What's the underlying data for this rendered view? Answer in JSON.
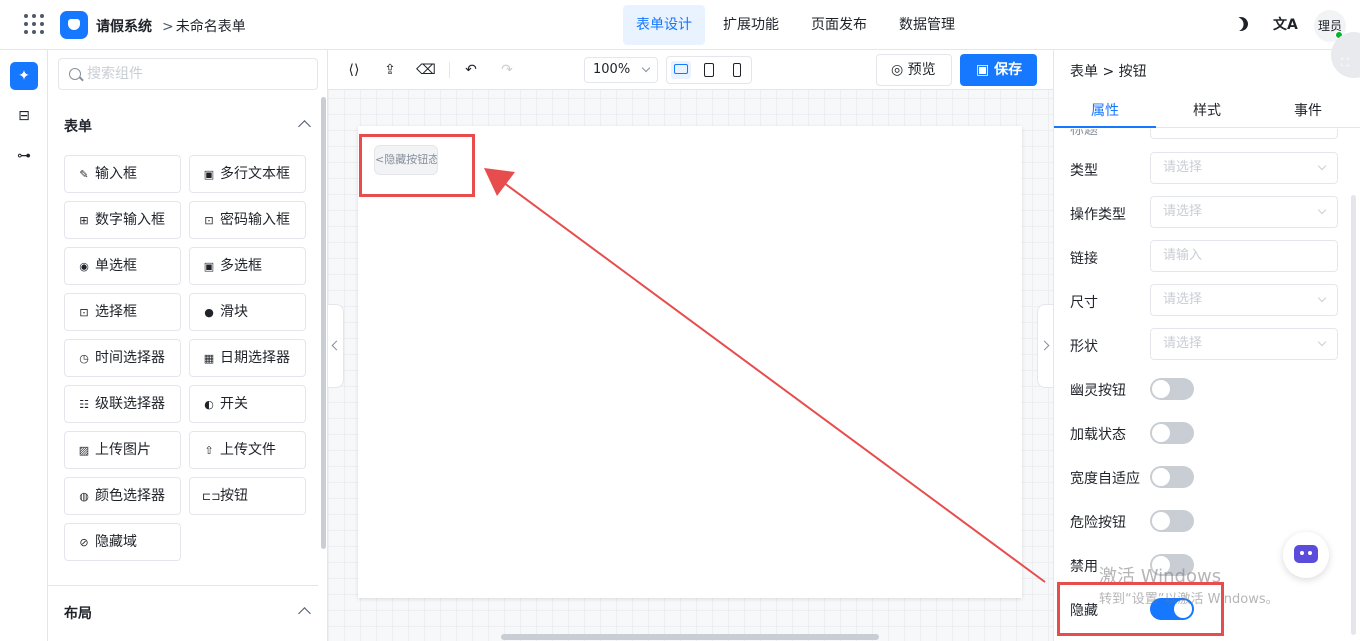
{
  "header": {
    "app_name": "请假系统",
    "breadcrumb_chevron": ">",
    "form_name": "未命名表单",
    "tabs": [
      {
        "label": "表单设计",
        "active": true
      },
      {
        "label": "扩展功能",
        "active": false
      },
      {
        "label": "页面发布",
        "active": false
      },
      {
        "label": "数据管理",
        "active": false
      }
    ],
    "translate_glyph": "文A",
    "user_label": "理员"
  },
  "left_rail": {
    "icons": [
      "puzzle-icon",
      "template-icon",
      "tree-icon"
    ]
  },
  "component_panel": {
    "search_placeholder": "搜索组件",
    "form_section_title": "表单",
    "components": [
      {
        "label": "输入框",
        "icon": "edit-icon",
        "glyph": "✎"
      },
      {
        "label": "多行文本框",
        "icon": "textarea-icon",
        "glyph": "▣"
      },
      {
        "label": "数字输入框",
        "icon": "number-icon",
        "glyph": "⊞"
      },
      {
        "label": "密码输入框",
        "icon": "lock-icon",
        "glyph": "⊡"
      },
      {
        "label": "单选框",
        "icon": "radio-icon",
        "glyph": "◉"
      },
      {
        "label": "多选框",
        "icon": "checkbox-icon",
        "glyph": "▣"
      },
      {
        "label": "选择框",
        "icon": "select-icon",
        "glyph": "⊡"
      },
      {
        "label": "滑块",
        "icon": "slider-icon",
        "glyph": "●"
      },
      {
        "label": "时间选择器",
        "icon": "clock-icon",
        "glyph": "◷"
      },
      {
        "label": "日期选择器",
        "icon": "calendar-icon",
        "glyph": "▦"
      },
      {
        "label": "级联选择器",
        "icon": "cascader-icon",
        "glyph": "☷"
      },
      {
        "label": "开关",
        "icon": "switch-icon",
        "glyph": "◐"
      },
      {
        "label": "上传图片",
        "icon": "image-icon",
        "glyph": "▨"
      },
      {
        "label": "上传文件",
        "icon": "upload-icon",
        "glyph": "⇧"
      },
      {
        "label": "颜色选择器",
        "icon": "palette-icon",
        "glyph": "◍"
      },
      {
        "label": "按钮",
        "icon": "button-icon",
        "glyph": "⊏⊐"
      },
      {
        "label": "隐藏域",
        "icon": "eye-off-icon",
        "glyph": "⊘"
      }
    ],
    "layout_section_title": "布局"
  },
  "toolbar": {
    "zoom": "100%",
    "preview_label": "预览",
    "save_label": "保存",
    "undo_glyph": "↶",
    "redo_glyph": "↷"
  },
  "canvas": {
    "button_chip_text": "<隐藏按钮态>"
  },
  "property_panel": {
    "breadcrumb": "表单 > 按钮",
    "tabs": [
      {
        "label": "属性",
        "active": true
      },
      {
        "label": "样式",
        "active": false
      },
      {
        "label": "事件",
        "active": false
      }
    ],
    "partial_row_label": "标题",
    "fields": [
      {
        "label": "类型",
        "placeholder": "请选择",
        "kind": "select"
      },
      {
        "label": "操作类型",
        "placeholder": "请选择",
        "kind": "select"
      },
      {
        "label": "链接",
        "placeholder": "请输入",
        "kind": "input"
      },
      {
        "label": "尺寸",
        "placeholder": "请选择",
        "kind": "select"
      },
      {
        "label": "形状",
        "placeholder": "请选择",
        "kind": "select"
      }
    ],
    "switches": [
      {
        "label": "幽灵按钮",
        "on": false
      },
      {
        "label": "加载状态",
        "on": false
      },
      {
        "label": "宽度自适应",
        "on": false
      },
      {
        "label": "危险按钮",
        "on": false
      },
      {
        "label": "禁用",
        "on": false
      },
      {
        "label": "隐藏",
        "on": true
      }
    ]
  },
  "watermark": {
    "line1": "激活 Windows",
    "line2": "转到“设置”以激活 Windows。"
  },
  "colors": {
    "accent": "#1677ff",
    "highlight": "#e84d4d"
  }
}
